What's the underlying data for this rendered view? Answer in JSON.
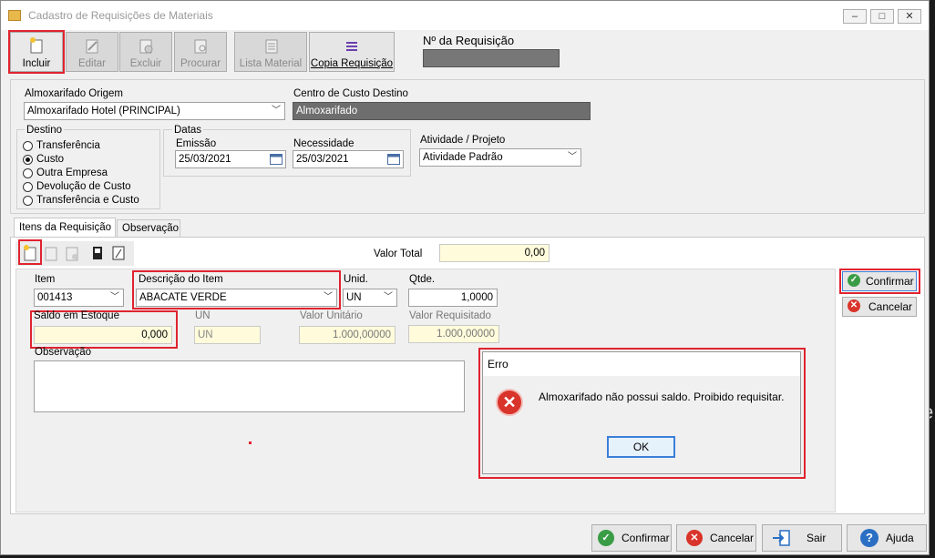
{
  "window": {
    "title": "Cadastro de Requisições de Materiais",
    "controls": [
      "_",
      "□",
      "✕"
    ]
  },
  "toolbar": {
    "incluir": "Incluir",
    "editar": "Editar",
    "excluir": "Excluir",
    "procurar": "Procurar",
    "lista_material": "Lista Material",
    "copia_requisicao": "Copia Requisição"
  },
  "requisicao": {
    "label": "Nº da Requisição",
    "value": ""
  },
  "form": {
    "almox_label": "Almoxarifado Origem",
    "almox_value": "Almoxarifado Hotel (PRINCIPAL)",
    "centro_label": "Centro de Custo Destino",
    "centro_value": "Almoxarifado",
    "destino_label": "Destino",
    "destino_options": [
      "Transferência",
      "Custo",
      "Outra Empresa",
      "Devolução de Custo",
      "Transferência e Custo"
    ],
    "destino_selected": 1,
    "datas_label": "Datas",
    "emissao_label": "Emissão",
    "emissao_value": "25/03/2021",
    "necessidade_label": "Necessidade",
    "necessidade_value": "25/03/2021",
    "atividade_label": "Atividade / Projeto",
    "atividade_value": "Atividade Padrão"
  },
  "tabs": {
    "itens": "Itens da Requisição",
    "observacao": "Observação"
  },
  "valor_total": {
    "label": "Valor Total",
    "value": "0,00"
  },
  "item": {
    "item_label": "Item",
    "item_value": "001413",
    "descricao_label": "Descrição do Item",
    "descricao_value": "ABACATE VERDE",
    "unid_label": "Unid.",
    "unid_value": "UN",
    "qtde_label": "Qtde.",
    "qtde_value": "1,0000",
    "saldo_label": "Saldo em Estoque",
    "saldo_value": "0,000",
    "un_label": "UN",
    "un_value": "UN",
    "valor_unit_label": "Valor Unitário",
    "valor_unit_value": "1.000,00000",
    "valor_req_label": "Valor Requisitado",
    "valor_req_value": "1.000,00000",
    "obs_label": "Observação"
  },
  "side_buttons": {
    "confirmar": "Confirmar",
    "cancelar": "Cancelar"
  },
  "dialog": {
    "title": "Erro",
    "message": "Almoxarifado não possui saldo. Proibido requisitar.",
    "ok": "OK"
  },
  "bottom_buttons": {
    "confirmar": "Confirmar",
    "cancelar": "Cancelar",
    "sair": "Sair",
    "ajuda": "Ajuda"
  },
  "colors": {
    "highlight_red": "#e0232f",
    "confirm_green": "#3a9d46",
    "cancel_red": "#d9342b",
    "help_blue": "#2a6fc4",
    "readonly_yellow": "#fffbdb"
  }
}
